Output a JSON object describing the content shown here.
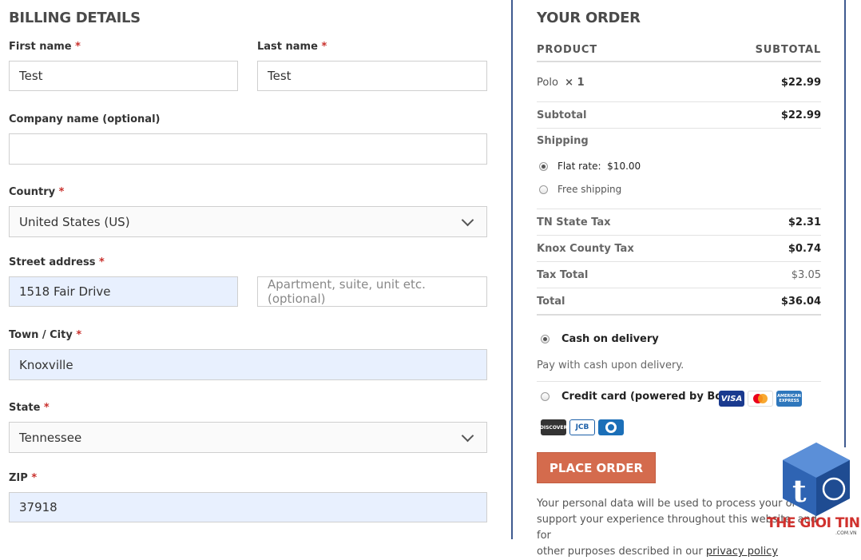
{
  "billing": {
    "title": "BILLING DETAILS",
    "required_mark": "*",
    "first_name": {
      "label": "First name",
      "value": "Test"
    },
    "last_name": {
      "label": "Last name",
      "value": "Test"
    },
    "company": {
      "label": "Company name (optional)",
      "value": ""
    },
    "country": {
      "label": "Country",
      "value": "United States (US)"
    },
    "street": {
      "label": "Street address",
      "value": "1518 Fair Drive",
      "apt_placeholder": "Apartment, suite, unit etc. (optional)"
    },
    "city": {
      "label": "Town / City",
      "value": "Knoxville"
    },
    "state": {
      "label": "State",
      "value": "Tennessee"
    },
    "zip": {
      "label": "ZIP",
      "value": "37918"
    }
  },
  "order": {
    "title": "YOUR ORDER",
    "col_product": "PRODUCT",
    "col_subtotal": "SUBTOTAL",
    "item": {
      "name": "Polo",
      "qty": "× 1",
      "price": "$22.99"
    },
    "subtotal": {
      "label": "Subtotal",
      "value": "$22.99"
    },
    "shipping": {
      "label": "Shipping",
      "options": [
        {
          "label": "Flat rate:",
          "price": "$10.00",
          "selected": true
        },
        {
          "label": "Free shipping",
          "selected": false
        }
      ]
    },
    "taxes": [
      {
        "label": "TN State Tax",
        "value": "$2.31"
      },
      {
        "label": "Knox County Tax",
        "value": "$0.74"
      }
    ],
    "tax_total": {
      "label": "Tax Total",
      "value": "$3.05"
    },
    "total": {
      "label": "Total",
      "value": "$36.04"
    }
  },
  "payment": {
    "cod": {
      "label": "Cash on delivery",
      "description": "Pay with cash upon delivery.",
      "selected": true
    },
    "credit": {
      "label": "Credit card (powered by Bolt)",
      "selected": false
    },
    "card_icons": [
      "visa",
      "mastercard",
      "amex",
      "discover",
      "jcb",
      "diners"
    ],
    "card_text": {
      "visa": "VISA",
      "amex": "AMERICAN EXPRESS",
      "discover": "DISCOVER",
      "jcb": "JCB"
    }
  },
  "place_order": "PLACE ORDER",
  "privacy": {
    "line1": "Your personal data will be used to process your order,",
    "line2": "support your experience throughout this website, and for",
    "line3_pre": "other purposes described in our ",
    "link": "privacy policy"
  },
  "watermark": {
    "text": "THE GIOI TINHOC",
    "sub": ".COM.VN"
  },
  "colors": {
    "accent_button": "#d46b4d",
    "panel_border": "#3f5a8f",
    "autofill": "#e8f0fe",
    "required": "#c9302c"
  }
}
